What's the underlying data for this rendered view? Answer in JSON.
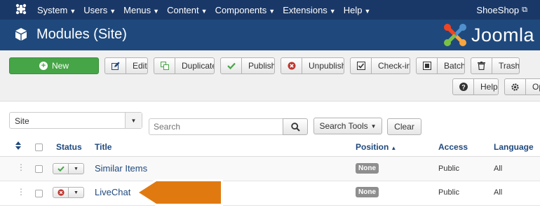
{
  "topnav": {
    "menus": [
      {
        "label": "System"
      },
      {
        "label": "Users"
      },
      {
        "label": "Menus"
      },
      {
        "label": "Content"
      },
      {
        "label": "Components"
      },
      {
        "label": "Extensions"
      },
      {
        "label": "Help"
      }
    ],
    "site_name": "ShoeShop"
  },
  "header": {
    "title": "Modules (Site)",
    "brand": "Joomla"
  },
  "toolbar": {
    "new": "New",
    "edit": "Edit",
    "duplicate": "Duplicate",
    "publish": "Publish",
    "unpublish": "Unpublish",
    "checkin": "Check-in",
    "batch": "Batch",
    "trash": "Trash",
    "help": "Help",
    "options": "Options"
  },
  "filters": {
    "client_value": "Site",
    "search_placeholder": "Search",
    "search_tools": "Search Tools",
    "clear": "Clear"
  },
  "table": {
    "headers": {
      "status": "Status",
      "title": "Title",
      "position": "Position",
      "access": "Access",
      "language": "Language"
    },
    "rows": [
      {
        "title": "Similar Items",
        "status": "published",
        "position": "None",
        "access": "Public",
        "language": "All"
      },
      {
        "title": "LiveChat",
        "status": "unpublished",
        "position": "None",
        "access": "Public",
        "language": "All"
      }
    ]
  },
  "colors": {
    "topnav": "#1a3867",
    "header": "#1f497d",
    "new_button": "#46a546",
    "link": "#1f497d",
    "annotation_arrow": "#e07a10",
    "published": "#46a546",
    "unpublished": "#bd362f"
  }
}
